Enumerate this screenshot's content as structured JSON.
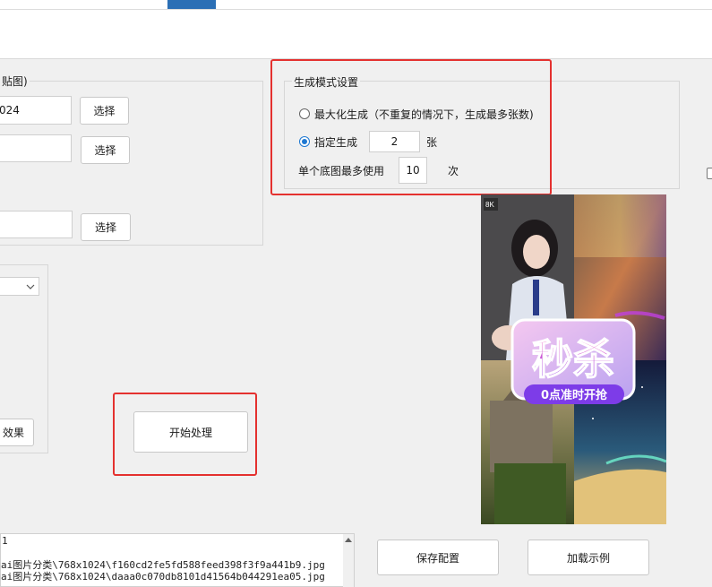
{
  "left_panel": {
    "group1_title_fragment": "贴图)",
    "size_value_fragment": "024",
    "choose1_label": "选择",
    "choose2_label": "选择",
    "choose3_label": "选择",
    "effect_button_fragment": "效果"
  },
  "mode_settings": {
    "title": "生成模式设置",
    "option_max_label": "最大化生成（不重复的情况下，生成最多张数)",
    "option_max_checked": false,
    "option_specify_label": "指定生成",
    "option_specify_checked": true,
    "specify_count": "2",
    "specify_unit": "张",
    "max_use_label": "单个底图最多使用",
    "max_use_value": "10",
    "max_use_unit": "次"
  },
  "preview": {
    "badge_text": "8K",
    "sticker_main": "秒杀",
    "sticker_sub": "0点准时开抢"
  },
  "actions": {
    "start_label": "开始处理",
    "save_config_label": "保存配置",
    "load_example_label": "加载示例"
  },
  "log": {
    "lines": [
      "1",
      "",
      "ai图片分类\\768x1024\\f160cd2fe5fd588feed398f3f9a441b9.jpg",
      "ai图片分类\\768x1024\\daaa0c070db8101d41564b044291ea05.jpg"
    ]
  },
  "colors": {
    "highlight_red": "#e4312f",
    "radio_blue": "#1e78d2",
    "tab_blue": "#2b6fb5"
  }
}
